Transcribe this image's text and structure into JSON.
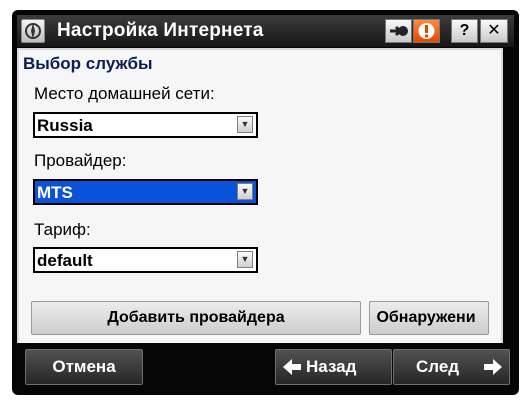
{
  "window": {
    "title": "Настройка Интернета",
    "buttons": {
      "help": "?",
      "close": "✕"
    }
  },
  "section": {
    "title": "Выбор службы"
  },
  "fields": {
    "home_network": {
      "label": "Место домашней сети:",
      "value": "Russia"
    },
    "provider": {
      "label": "Провайдер:",
      "value": "MTS"
    },
    "tariff": {
      "label": "Тариф:",
      "value": "default"
    }
  },
  "actions": {
    "add_provider": "Добавить провайдера",
    "discover": "Обнаружени"
  },
  "bottom": {
    "cancel": "Отмена",
    "back": "Назад",
    "next": "След"
  },
  "icons": {
    "app": "compass-icon",
    "connect": "connect-icon",
    "alert": "alert-icon",
    "dropdown": "chevron-down-icon",
    "back": "arrow-left-icon",
    "next": "arrow-right-icon"
  },
  "colors": {
    "selection": "#0a52d9",
    "alert": "#e04a00",
    "title_text": "#0a1d55"
  }
}
